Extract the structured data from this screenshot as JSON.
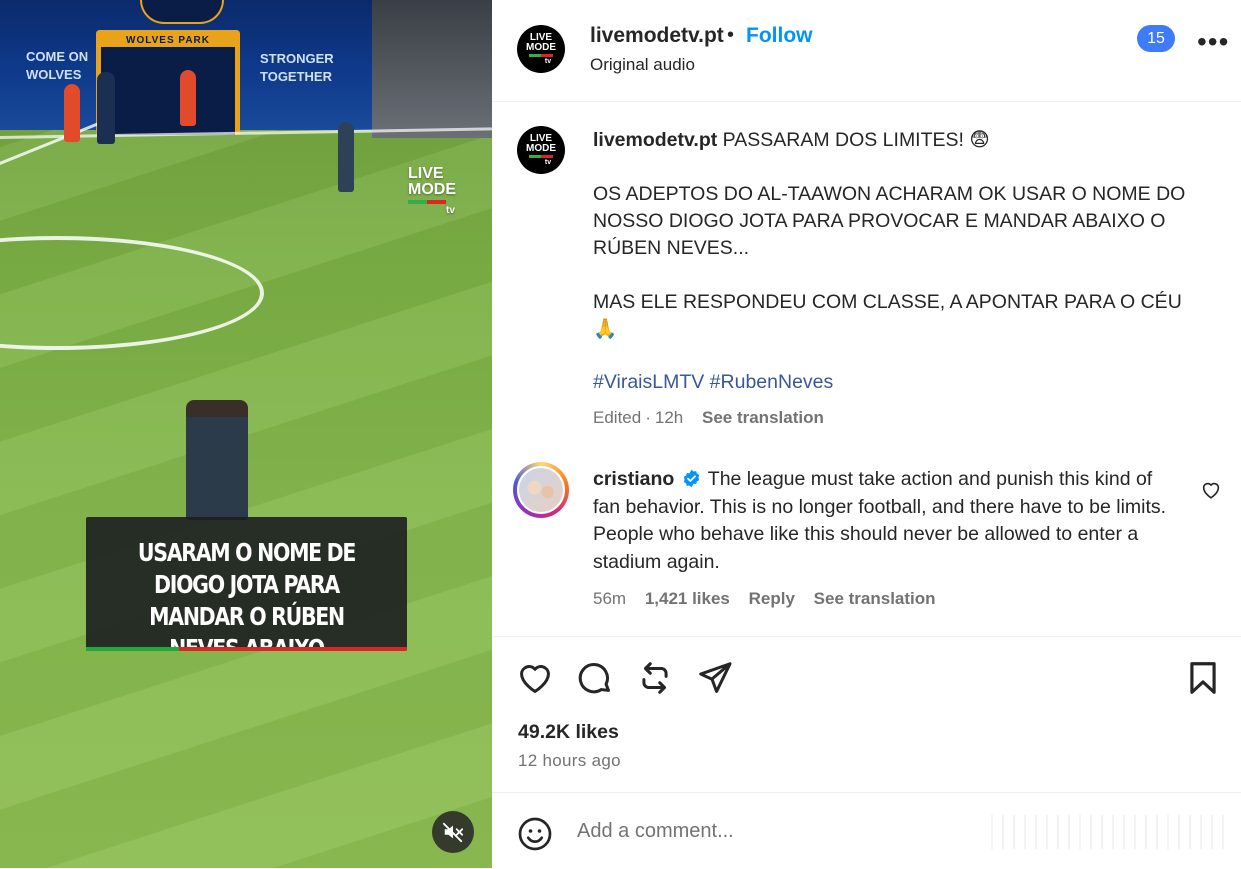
{
  "video": {
    "stand_text_left": "COME ON\nWOLVES",
    "stand_text_right": "STRONGER\nTOGETHER",
    "tunnel_title": "WOLVES PARK",
    "watermark": {
      "line1": "LIVE",
      "line2": "MODE",
      "line3": "tv"
    },
    "caption": "USARAM O NOME DE DIOGO JOTA PARA MANDAR O RÚBEN NEVES ABAIXO",
    "mute_icon": "speaker-muted-icon"
  },
  "header": {
    "username": "livemodetv.pt",
    "dot": "•",
    "follow_label": "Follow",
    "audio": "Original audio",
    "badge_count": "15",
    "more_label": "•••",
    "avatar": {
      "line1": "LIVE",
      "line2": "MODE",
      "line3": "tv"
    }
  },
  "post": {
    "author": "livemodetv.pt",
    "headline": "PASSARAM DOS LIMITES! 😨",
    "paragraph1": "OS ADEPTOS DO AL-TAAWON ACHARAM OK USAR O NOME DO NOSSO DIOGO JOTA PARA PROVOCAR E MANDAR ABAIXO O RÚBEN NEVES...",
    "paragraph2": "MAS ELE RESPONDEU COM CLASSE, A APONTAR PARA O CÉU 🙏",
    "hashtags": "#ViraisLMTV #RubenNeves",
    "edited": "Edited",
    "sep": "·",
    "age": "12h",
    "see_translation": "See translation"
  },
  "comment": {
    "username": "cristiano",
    "text": "The league must take action and punish this kind of fan behavior. This is no longer football, and there have to be limits. People who behave like this should never be allowed to enter a stadium again.",
    "age": "56m",
    "likes": "1,421 likes",
    "reply": "Reply",
    "see_translation": "See translation"
  },
  "actions": {
    "likes": "49.2K likes",
    "time_ago": "12 hours ago"
  },
  "comment_box": {
    "placeholder": "Add a comment..."
  },
  "colors": {
    "accent": "#0095f6",
    "hashtag": "#385898",
    "badge": "#3d7bf7",
    "muted": "#737373"
  }
}
